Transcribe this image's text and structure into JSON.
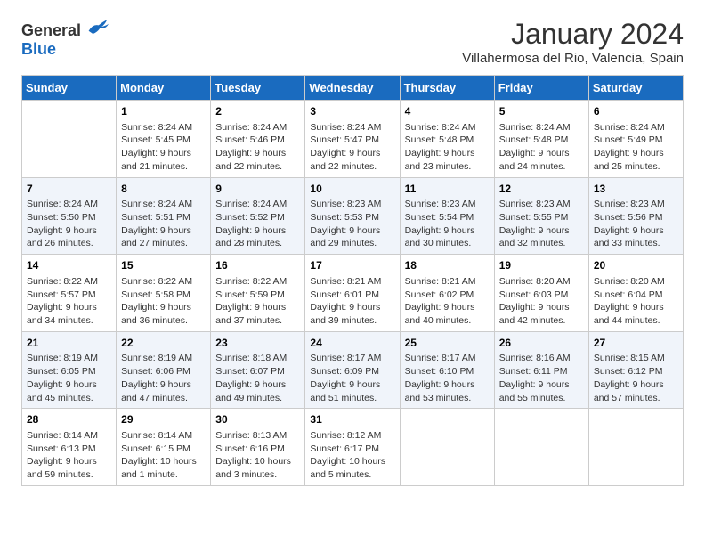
{
  "header": {
    "logo_general": "General",
    "logo_blue": "Blue",
    "title": "January 2024",
    "subtitle": "Villahermosa del Rio, Valencia, Spain"
  },
  "days_of_week": [
    "Sunday",
    "Monday",
    "Tuesday",
    "Wednesday",
    "Thursday",
    "Friday",
    "Saturday"
  ],
  "weeks": [
    [
      {
        "date": "",
        "sunrise": "",
        "sunset": "",
        "daylight": ""
      },
      {
        "date": "1",
        "sunrise": "Sunrise: 8:24 AM",
        "sunset": "Sunset: 5:45 PM",
        "daylight": "Daylight: 9 hours and 21 minutes."
      },
      {
        "date": "2",
        "sunrise": "Sunrise: 8:24 AM",
        "sunset": "Sunset: 5:46 PM",
        "daylight": "Daylight: 9 hours and 22 minutes."
      },
      {
        "date": "3",
        "sunrise": "Sunrise: 8:24 AM",
        "sunset": "Sunset: 5:47 PM",
        "daylight": "Daylight: 9 hours and 22 minutes."
      },
      {
        "date": "4",
        "sunrise": "Sunrise: 8:24 AM",
        "sunset": "Sunset: 5:48 PM",
        "daylight": "Daylight: 9 hours and 23 minutes."
      },
      {
        "date": "5",
        "sunrise": "Sunrise: 8:24 AM",
        "sunset": "Sunset: 5:48 PM",
        "daylight": "Daylight: 9 hours and 24 minutes."
      },
      {
        "date": "6",
        "sunrise": "Sunrise: 8:24 AM",
        "sunset": "Sunset: 5:49 PM",
        "daylight": "Daylight: 9 hours and 25 minutes."
      }
    ],
    [
      {
        "date": "7",
        "sunrise": "Sunrise: 8:24 AM",
        "sunset": "Sunset: 5:50 PM",
        "daylight": "Daylight: 9 hours and 26 minutes."
      },
      {
        "date": "8",
        "sunrise": "Sunrise: 8:24 AM",
        "sunset": "Sunset: 5:51 PM",
        "daylight": "Daylight: 9 hours and 27 minutes."
      },
      {
        "date": "9",
        "sunrise": "Sunrise: 8:24 AM",
        "sunset": "Sunset: 5:52 PM",
        "daylight": "Daylight: 9 hours and 28 minutes."
      },
      {
        "date": "10",
        "sunrise": "Sunrise: 8:23 AM",
        "sunset": "Sunset: 5:53 PM",
        "daylight": "Daylight: 9 hours and 29 minutes."
      },
      {
        "date": "11",
        "sunrise": "Sunrise: 8:23 AM",
        "sunset": "Sunset: 5:54 PM",
        "daylight": "Daylight: 9 hours and 30 minutes."
      },
      {
        "date": "12",
        "sunrise": "Sunrise: 8:23 AM",
        "sunset": "Sunset: 5:55 PM",
        "daylight": "Daylight: 9 hours and 32 minutes."
      },
      {
        "date": "13",
        "sunrise": "Sunrise: 8:23 AM",
        "sunset": "Sunset: 5:56 PM",
        "daylight": "Daylight: 9 hours and 33 minutes."
      }
    ],
    [
      {
        "date": "14",
        "sunrise": "Sunrise: 8:22 AM",
        "sunset": "Sunset: 5:57 PM",
        "daylight": "Daylight: 9 hours and 34 minutes."
      },
      {
        "date": "15",
        "sunrise": "Sunrise: 8:22 AM",
        "sunset": "Sunset: 5:58 PM",
        "daylight": "Daylight: 9 hours and 36 minutes."
      },
      {
        "date": "16",
        "sunrise": "Sunrise: 8:22 AM",
        "sunset": "Sunset: 5:59 PM",
        "daylight": "Daylight: 9 hours and 37 minutes."
      },
      {
        "date": "17",
        "sunrise": "Sunrise: 8:21 AM",
        "sunset": "Sunset: 6:01 PM",
        "daylight": "Daylight: 9 hours and 39 minutes."
      },
      {
        "date": "18",
        "sunrise": "Sunrise: 8:21 AM",
        "sunset": "Sunset: 6:02 PM",
        "daylight": "Daylight: 9 hours and 40 minutes."
      },
      {
        "date": "19",
        "sunrise": "Sunrise: 8:20 AM",
        "sunset": "Sunset: 6:03 PM",
        "daylight": "Daylight: 9 hours and 42 minutes."
      },
      {
        "date": "20",
        "sunrise": "Sunrise: 8:20 AM",
        "sunset": "Sunset: 6:04 PM",
        "daylight": "Daylight: 9 hours and 44 minutes."
      }
    ],
    [
      {
        "date": "21",
        "sunrise": "Sunrise: 8:19 AM",
        "sunset": "Sunset: 6:05 PM",
        "daylight": "Daylight: 9 hours and 45 minutes."
      },
      {
        "date": "22",
        "sunrise": "Sunrise: 8:19 AM",
        "sunset": "Sunset: 6:06 PM",
        "daylight": "Daylight: 9 hours and 47 minutes."
      },
      {
        "date": "23",
        "sunrise": "Sunrise: 8:18 AM",
        "sunset": "Sunset: 6:07 PM",
        "daylight": "Daylight: 9 hours and 49 minutes."
      },
      {
        "date": "24",
        "sunrise": "Sunrise: 8:17 AM",
        "sunset": "Sunset: 6:09 PM",
        "daylight": "Daylight: 9 hours and 51 minutes."
      },
      {
        "date": "25",
        "sunrise": "Sunrise: 8:17 AM",
        "sunset": "Sunset: 6:10 PM",
        "daylight": "Daylight: 9 hours and 53 minutes."
      },
      {
        "date": "26",
        "sunrise": "Sunrise: 8:16 AM",
        "sunset": "Sunset: 6:11 PM",
        "daylight": "Daylight: 9 hours and 55 minutes."
      },
      {
        "date": "27",
        "sunrise": "Sunrise: 8:15 AM",
        "sunset": "Sunset: 6:12 PM",
        "daylight": "Daylight: 9 hours and 57 minutes."
      }
    ],
    [
      {
        "date": "28",
        "sunrise": "Sunrise: 8:14 AM",
        "sunset": "Sunset: 6:13 PM",
        "daylight": "Daylight: 9 hours and 59 minutes."
      },
      {
        "date": "29",
        "sunrise": "Sunrise: 8:14 AM",
        "sunset": "Sunset: 6:15 PM",
        "daylight": "Daylight: 10 hours and 1 minute."
      },
      {
        "date": "30",
        "sunrise": "Sunrise: 8:13 AM",
        "sunset": "Sunset: 6:16 PM",
        "daylight": "Daylight: 10 hours and 3 minutes."
      },
      {
        "date": "31",
        "sunrise": "Sunrise: 8:12 AM",
        "sunset": "Sunset: 6:17 PM",
        "daylight": "Daylight: 10 hours and 5 minutes."
      },
      {
        "date": "",
        "sunrise": "",
        "sunset": "",
        "daylight": ""
      },
      {
        "date": "",
        "sunrise": "",
        "sunset": "",
        "daylight": ""
      },
      {
        "date": "",
        "sunrise": "",
        "sunset": "",
        "daylight": ""
      }
    ]
  ]
}
